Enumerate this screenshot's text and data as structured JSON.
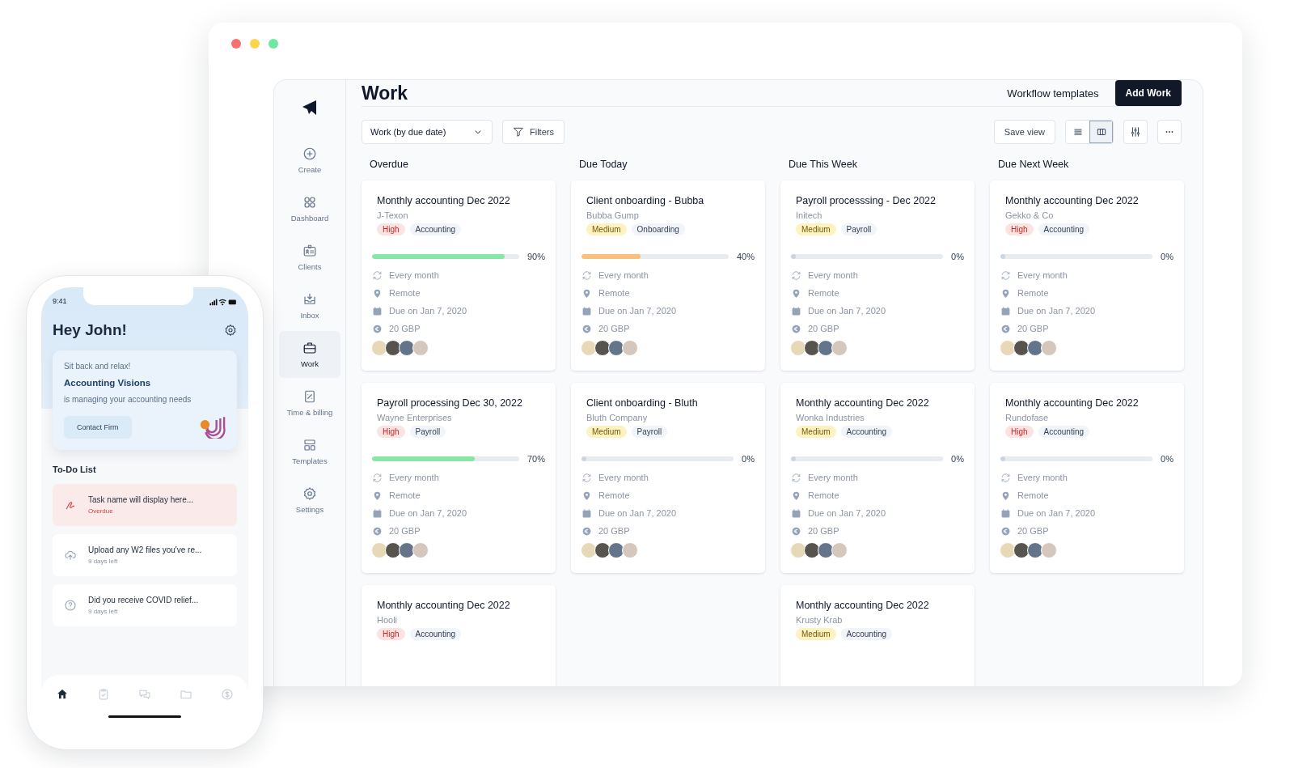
{
  "sidebar": {
    "items": [
      {
        "kind": "create",
        "label": "Create",
        "selected": false
      },
      {
        "kind": "dashboard",
        "label": "Dashboard",
        "selected": false
      },
      {
        "kind": "clients",
        "label": "Clients",
        "selected": false
      },
      {
        "kind": "inbox",
        "label": "Inbox",
        "selected": false
      },
      {
        "kind": "work",
        "label": "Work",
        "selected": true
      },
      {
        "kind": "time",
        "label": "Time & billing",
        "selected": false
      },
      {
        "kind": "templates",
        "label": "Templates",
        "selected": false
      },
      {
        "kind": "settings",
        "label": "Settings",
        "selected": false
      }
    ]
  },
  "header": {
    "title": "Work",
    "link": "Workflow templates",
    "button": "Add Work"
  },
  "toolbar": {
    "view_select": "Work (by due date)",
    "filters": "Filters",
    "save_view": "Save view",
    "view_toggle": [
      {
        "kind": "list",
        "selected": false
      },
      {
        "kind": "board",
        "selected": true
      }
    ]
  },
  "columns": [
    {
      "title": "Overdue",
      "cards": [
        {
          "title": "Monthly accounting Dec 2022",
          "client": "J-Texon",
          "priority": {
            "label": "High",
            "kind": "high"
          },
          "category": "Accounting",
          "progress": {
            "level": 0.9,
            "reading": "90%",
            "color": "#86e8a4"
          },
          "details": [
            "Every month",
            "Remote",
            "Due on Jan 7, 2020",
            "20 GBP"
          ]
        },
        {
          "title": "Payroll processing Dec 30, 2022",
          "client": "Wayne Enterprises",
          "priority": {
            "label": "High",
            "kind": "high"
          },
          "category": "Payroll",
          "progress": {
            "level": 0.7,
            "reading": "70%",
            "color": "#86e8a4"
          },
          "details": [
            "Every month",
            "Remote",
            "Due on Jan 7, 2020",
            "20 GBP"
          ]
        },
        {
          "title": "Monthly accounting Dec 2022",
          "client": "Hooli",
          "priority": {
            "label": "High",
            "kind": "high"
          },
          "category": "Accounting"
        }
      ]
    },
    {
      "title": "Due Today",
      "cards": [
        {
          "title": "Client onboarding - Bubba",
          "client": "Bubba Gump",
          "priority": {
            "label": "Medium",
            "kind": "medium"
          },
          "category": "Onboarding",
          "progress": {
            "level": 0.4,
            "reading": "40%",
            "color": "#fbbf7c"
          },
          "details": [
            "Every month",
            "Remote",
            "Due on Jan 7, 2020",
            "20 GBP"
          ]
        },
        {
          "title": "Client onboarding - Bluth",
          "client": "Bluth Company",
          "priority": {
            "label": "Medium",
            "kind": "medium"
          },
          "category": "Payroll",
          "progress": {
            "level": 0,
            "reading": "0%",
            "color": "#cbd5e1"
          },
          "details": [
            "Every month",
            "Remote",
            "Due on Jan 7, 2020",
            "20 GBP"
          ]
        }
      ]
    },
    {
      "title": "Due This Week",
      "cards": [
        {
          "title": "Payroll processsing - Dec 2022",
          "client": "Initech",
          "priority": {
            "label": "Medium",
            "kind": "medium"
          },
          "category": "Payroll",
          "progress": {
            "level": 0,
            "reading": "0%",
            "color": "#cbd5e1"
          },
          "details": [
            "Every month",
            "Remote",
            "Due on Jan 7, 2020",
            "20 GBP"
          ]
        },
        {
          "title": "Monthly accounting Dec 2022",
          "client": "Wonka Industries",
          "priority": {
            "label": "Medium",
            "kind": "medium"
          },
          "category": "Accounting",
          "progress": {
            "level": 0,
            "reading": "0%",
            "color": "#cbd5e1"
          },
          "details": [
            "Every month",
            "Remote",
            "Due on Jan 7, 2020",
            "20 GBP"
          ]
        },
        {
          "title": "Monthly accounting Dec 2022",
          "client": "Krusty Krab",
          "priority": {
            "label": "Medium",
            "kind": "medium"
          },
          "category": "Accounting"
        }
      ]
    },
    {
      "title": "Due Next Week",
      "cards": [
        {
          "title": "Monthly accounting Dec 2022",
          "client": "Gekko & Co",
          "priority": {
            "label": "High",
            "kind": "high"
          },
          "category": "Accounting",
          "progress": {
            "level": 0,
            "reading": "0%",
            "color": "#cbd5e1"
          },
          "details": [
            "Every month",
            "Remote",
            "Due on Jan 7, 2020",
            "20 GBP"
          ]
        },
        {
          "title": "Monthly accounting Dec 2022",
          "client": "Rundofase",
          "priority": {
            "label": "High",
            "kind": "high"
          },
          "category": "Accounting",
          "progress": {
            "level": 0,
            "reading": "0%",
            "color": "#cbd5e1"
          },
          "details": [
            "Every month",
            "Remote",
            "Due on Jan 7, 2020",
            "20 GBP"
          ]
        }
      ]
    }
  ],
  "phone": {
    "time": "9:41",
    "greeting": "Hey John!",
    "firm_card": {
      "intro": "Sit back and relax!",
      "firm": "Accounting Visions",
      "note": "is managing your accounting needs",
      "button": "Contact Firm"
    },
    "todo_title": "To-Do List",
    "todos": [
      {
        "kind": "sign",
        "title": "Task name will display here...",
        "note": "Overdue",
        "overdue": true
      },
      {
        "kind": "upload",
        "title": "Upload any W2 files you've re...",
        "note": "9 days left",
        "overdue": false
      },
      {
        "kind": "question",
        "title": "Did you receive COVID relief...",
        "note": "9 days left",
        "overdue": false
      }
    ],
    "tab_bar": [
      {
        "kind": "home",
        "selected": true
      },
      {
        "kind": "tasks",
        "selected": false
      },
      {
        "kind": "chat",
        "selected": false
      },
      {
        "kind": "folder",
        "selected": false
      },
      {
        "kind": "money",
        "selected": false
      }
    ]
  }
}
